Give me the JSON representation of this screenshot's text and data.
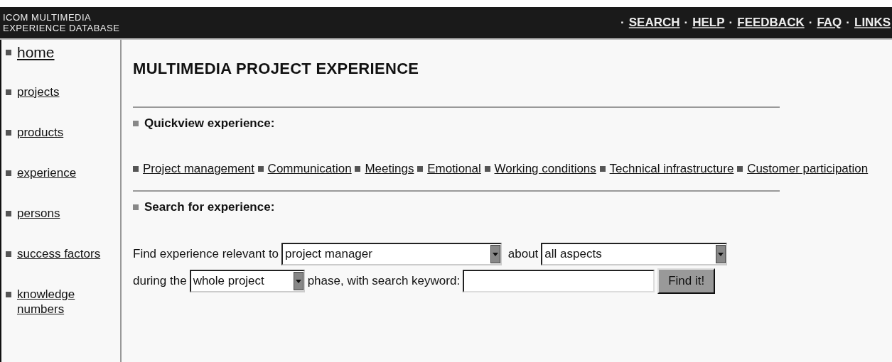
{
  "header": {
    "title_lines": [
      "ICOM MULTIMEDIA",
      "EXPERIENCE DATABASE"
    ],
    "links": [
      {
        "prefix": "·",
        "label": "SEARCH"
      },
      {
        "prefix": "·",
        "label": "HELP"
      },
      {
        "prefix": "·",
        "label": "FEEDBACK"
      },
      {
        "prefix": "·",
        "label": "FAQ"
      },
      {
        "prefix": "·",
        "label": "LINKS"
      }
    ]
  },
  "sidebar": {
    "items": [
      {
        "label": "home",
        "kind": "large"
      },
      {
        "label": "projects",
        "kind": "normal"
      },
      {
        "label": "products",
        "kind": "normal"
      },
      {
        "label": "experience",
        "kind": "normal"
      },
      {
        "label": "persons",
        "kind": "normal"
      },
      {
        "label": "success factors",
        "kind": "normal"
      },
      {
        "label": "knowledge numbers",
        "kind": "normal"
      }
    ]
  },
  "main": {
    "title": "MULTIMEDIA PROJECT EXPERIENCE",
    "quickview": {
      "heading": "Quickview experience:",
      "links": [
        "Project management",
        "Communication",
        "Meetings",
        "Emotional",
        "Working conditions",
        "Technical infrastructure",
        "Customer participation"
      ]
    },
    "search": {
      "heading": "Search for experience:",
      "text_1": "Find experience relevant to",
      "role_select": "project manager",
      "text_2": "about",
      "aspect_select": "all aspects",
      "text_3": "during the",
      "phase_select": "whole project",
      "text_4": "phase, with search keyword:",
      "button": "Find it!"
    }
  }
}
